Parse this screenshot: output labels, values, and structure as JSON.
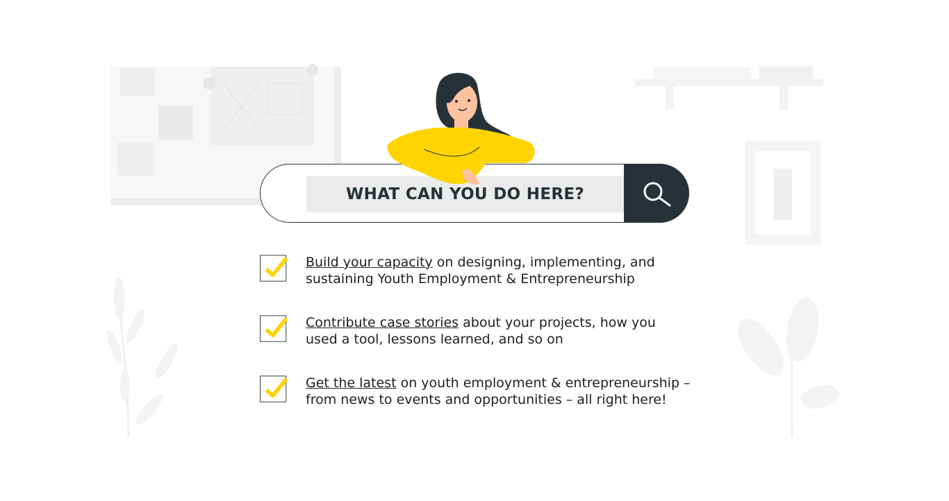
{
  "search": {
    "query_text": "WHAT CAN YOU DO HERE?",
    "button_icon": "search-icon"
  },
  "features": [
    {
      "link_text": "Build your capacity",
      "rest_line1": " on designing, implementing, and",
      "line2": "sustaining Youth Employment & Entrepreneurship",
      "icon": "checkmark-icon"
    },
    {
      "link_text": "Contribute case stories",
      "rest_line1": " about your projects, how you",
      "line2": "used a tool, lessons learned, and so on",
      "icon": "checkmark-icon"
    },
    {
      "link_text": "Get the latest",
      "rest_line1": " on youth employment & entrepreneurship –",
      "line2": "from news to events and opportunities – all right here!",
      "icon": "checkmark-icon"
    }
  ],
  "colors": {
    "dark": "#263238",
    "accent_yellow": "#ffd400",
    "field_gray": "#ebebeb",
    "background_gray": "#f5f5f5"
  }
}
